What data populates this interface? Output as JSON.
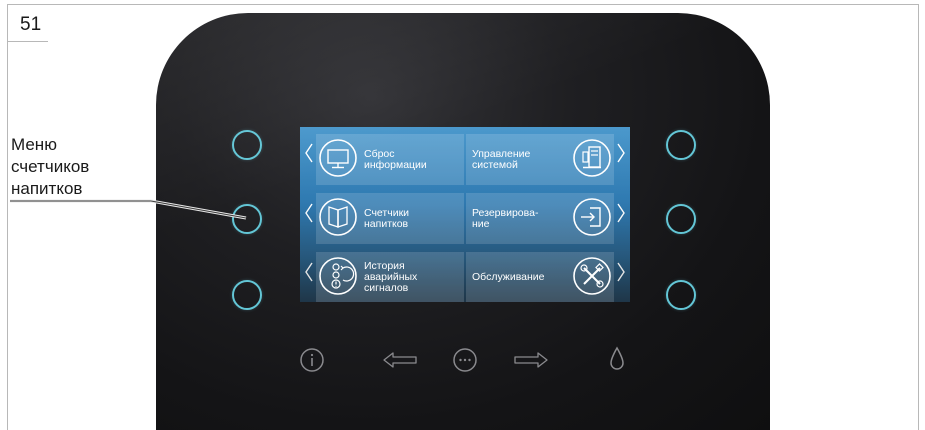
{
  "page": {
    "number": "51"
  },
  "callout": {
    "label": "Меню\nсчетчиков\nнапитков"
  },
  "menu": {
    "tiles": [
      {
        "label": "Сброс\nинформации",
        "icon": "monitor-icon"
      },
      {
        "label": "Управление\nсистемой",
        "icon": "system-control-icon"
      },
      {
        "label": "Счетчики\nнапитков",
        "icon": "book-icon"
      },
      {
        "label": "Резервирова-\nние",
        "icon": "enter-door-icon"
      },
      {
        "label": "История\nаварийных\nсигналов",
        "icon": "alarm-history-icon"
      },
      {
        "label": "Обслуживание",
        "icon": "tools-icon"
      }
    ]
  },
  "hardware": {
    "side_buttons": [
      "left-top",
      "left-middle",
      "left-bottom",
      "right-top",
      "right-middle",
      "right-bottom"
    ],
    "bottom_icons": [
      "info-icon",
      "arrow-left-icon",
      "more-icon",
      "arrow-right-icon",
      "drop-icon"
    ]
  },
  "colors": {
    "device_body": "#17171a",
    "button_ring": "#63c6d6",
    "screen_top": "#3c90c8",
    "screen_bottom": "#243f55"
  }
}
